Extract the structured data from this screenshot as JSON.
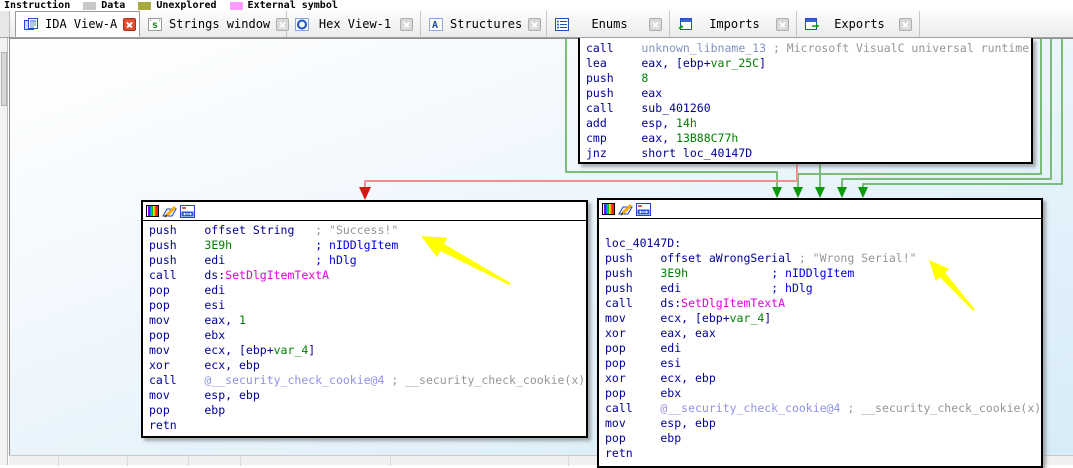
{
  "legend": {
    "items": [
      {
        "label": "Instruction",
        "swatch": null
      },
      {
        "label": "Data",
        "swatch": "#c8c8c8"
      },
      {
        "label": "Unexplored",
        "swatch": "#a9a942"
      },
      {
        "label": "External symbol",
        "swatch": "#fe9bfe"
      }
    ]
  },
  "tabs": [
    {
      "label": "IDA View-A",
      "icon": "ida-view-icon",
      "active": true
    },
    {
      "label": "Strings window",
      "icon": "strings-icon",
      "active": false
    },
    {
      "label": "Hex View-1",
      "icon": "hex-view-icon",
      "active": false
    },
    {
      "label": "Structures",
      "icon": "structures-icon",
      "active": false
    },
    {
      "label": "Enums",
      "icon": "enums-icon",
      "active": false
    },
    {
      "label": "Imports",
      "icon": "imports-icon",
      "active": false
    },
    {
      "label": "Exports",
      "icon": "exports-icon",
      "active": false
    }
  ],
  "graph": {
    "blocks": {
      "entry": {
        "lines": [
          [
            [
              "call    ",
              "c"
            ],
            [
              "unknown_libname_13",
              "l"
            ],
            [
              " ",
              "c"
            ],
            [
              "; Microsoft VisualC universal runtime",
              "g"
            ]
          ],
          [
            [
              "lea     eax, [ebp+",
              "c"
            ],
            [
              "var_25C",
              "n"
            ],
            [
              "]",
              "c"
            ]
          ],
          [
            [
              "push    ",
              "c"
            ],
            [
              "8",
              "n"
            ]
          ],
          [
            [
              "push    eax",
              "c"
            ]
          ],
          [
            [
              "call    sub_401260",
              "c"
            ]
          ],
          [
            [
              "add     esp, ",
              "c"
            ],
            [
              "14h",
              "n"
            ]
          ],
          [
            [
              "cmp     eax, ",
              "c"
            ],
            [
              "13B88C77h",
              "n"
            ]
          ],
          [
            [
              "jnz     short loc_40147D",
              "c"
            ]
          ]
        ]
      },
      "success": {
        "lines": [
          [
            [
              "push    offset String   ",
              "c"
            ],
            [
              "; \"Success!\"",
              "g"
            ]
          ],
          [
            [
              "push    ",
              "c"
            ],
            [
              "3E9h",
              "n"
            ],
            [
              "            ",
              "c"
            ],
            [
              "; nIDDlgItem",
              "b"
            ]
          ],
          [
            [
              "push    edi             ",
              "c"
            ],
            [
              "; hDlg",
              "b"
            ]
          ],
          [
            [
              "call    ds:",
              "c"
            ],
            [
              "SetDlgItemTextA",
              "m"
            ]
          ],
          [
            [
              "pop     edi",
              "c"
            ]
          ],
          [
            [
              "pop     esi",
              "c"
            ]
          ],
          [
            [
              "mov     eax, ",
              "c"
            ],
            [
              "1",
              "n"
            ]
          ],
          [
            [
              "pop     ebx",
              "c"
            ]
          ],
          [
            [
              "mov     ecx, [ebp+",
              "c"
            ],
            [
              "var_4",
              "n"
            ],
            [
              "]",
              "c"
            ]
          ],
          [
            [
              "xor     ecx, ebp",
              "c"
            ]
          ],
          [
            [
              "call    ",
              "c"
            ],
            [
              "@__security_check_cookie@4",
              "k"
            ],
            [
              " ",
              "c"
            ],
            [
              "; __security_check_cookie(x)",
              "g"
            ]
          ],
          [
            [
              "mov     esp, ebp",
              "c"
            ]
          ],
          [
            [
              "pop     ebp",
              "c"
            ]
          ],
          [
            [
              "retn",
              "c"
            ]
          ]
        ]
      },
      "wrong": {
        "lines": [
          [],
          [
            [
              "loc_40147D:",
              "c"
            ]
          ],
          [
            [
              "push    offset aWrongSerial ",
              "c"
            ],
            [
              "; \"Wrong Serial!\"",
              "g"
            ]
          ],
          [
            [
              "push    ",
              "c"
            ],
            [
              "3E9h",
              "n"
            ],
            [
              "            ",
              "c"
            ],
            [
              "; nIDDlgItem",
              "b"
            ]
          ],
          [
            [
              "push    edi             ",
              "c"
            ],
            [
              "; hDlg",
              "b"
            ]
          ],
          [
            [
              "call    ds:",
              "c"
            ],
            [
              "SetDlgItemTextA",
              "m"
            ]
          ],
          [
            [
              "mov     ecx, [ebp+",
              "c"
            ],
            [
              "var_4",
              "n"
            ],
            [
              "]",
              "c"
            ]
          ],
          [
            [
              "xor     eax, eax",
              "c"
            ]
          ],
          [
            [
              "pop     edi",
              "c"
            ]
          ],
          [
            [
              "pop     esi",
              "c"
            ]
          ],
          [
            [
              "xor     ecx, ebp",
              "c"
            ]
          ],
          [
            [
              "pop     ebx",
              "c"
            ]
          ],
          [
            [
              "call    ",
              "c"
            ],
            [
              "@__security_check_cookie@4",
              "k"
            ],
            [
              " ",
              "c"
            ],
            [
              "; __security_check_cookie(x)",
              "g"
            ]
          ],
          [
            [
              "mov     esp, ebp",
              "c"
            ]
          ],
          [
            [
              "pop     ebp",
              "c"
            ]
          ],
          [
            [
              "retn",
              "c"
            ]
          ]
        ]
      }
    },
    "edges": {
      "jump_color": "#79bd79",
      "jump_arrow": "#0b9a0b",
      "fallthrough_color": "#ef8f8f",
      "fallthrough_arrow": "#dc1414"
    },
    "annotation": {
      "color": "#ffff00"
    }
  }
}
